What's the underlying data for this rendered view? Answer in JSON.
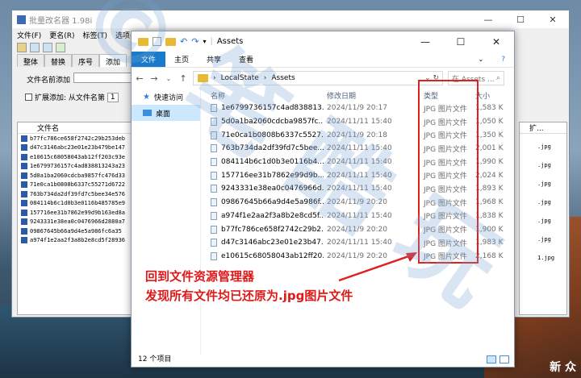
{
  "renamer": {
    "title": "批量改名器 1.98i",
    "menu": [
      "文件(F)",
      "更名(R)",
      "标签(T)",
      "选项(O)"
    ],
    "tabs": [
      "整体",
      "替换",
      "序号",
      "添加"
    ],
    "prefix_label": "文件名前添加",
    "ext_label": "扩展添加: 从文件名第",
    "ext_value": "1",
    "list_header": "文件名",
    "files": [
      "b77fc786ce658f2742c29b253deb",
      "d47c3146abc23e01e23b479be147",
      "e10615c68058043ab12ff203c93e",
      "1e6799736157c4ad838813243a23",
      "5d0a1ba2060cdcba9857fc476d33",
      "71e0ca1b0808b6337c55271d6722",
      "763b734da2df39fd7c5bee34e576",
      "084114b6c1d0b3e0116b485785e9",
      "157716ee31b7862e99d9b163ed8a",
      "9243331e38ea0c0476966d2880a7",
      "09867645b66a9d4e5a986fc6a35",
      "a974f1e2aa2f3a8b2e8cd5f28936"
    ],
    "right_header": "扩...",
    "right_items": [
      "",
      ".jpg",
      "",
      ".jpg",
      "",
      ".jpg",
      "",
      ".jpg",
      "",
      ".jpg",
      "",
      ".jpg",
      "",
      "1.jpg"
    ]
  },
  "explorer": {
    "title": "Assets",
    "ribbon": [
      "文件",
      "主页",
      "共享",
      "查看"
    ],
    "path": [
      "LocalState",
      "Assets"
    ],
    "search_placeholder": "在 Assets ...",
    "nav": [
      {
        "label": "快速访问",
        "icon": "star-icon"
      },
      {
        "label": "桌面",
        "icon": "desktop-icon"
      }
    ],
    "columns": {
      "name": "名称",
      "date": "修改日期",
      "type": "类型",
      "size": "大小"
    },
    "files": [
      {
        "name": "1e6799736157c4ad838813...",
        "date": "2024/11/9 20:17",
        "type": "JPG 图片文件",
        "size": "1,583 K"
      },
      {
        "name": "5d0a1ba2060cdcba9857fc...",
        "date": "2024/11/11 15:40",
        "type": "JPG 图片文件",
        "size": "1,050 K"
      },
      {
        "name": "71e0ca1b0808b6337c5527...",
        "date": "2024/11/9 20:18",
        "type": "JPG 图片文件",
        "size": "1,350 K"
      },
      {
        "name": "763b734da2df39fd7c5bee...",
        "date": "2024/11/11 15:40",
        "type": "JPG 图片文件",
        "size": "2,001 K"
      },
      {
        "name": "084114b6c1d0b3e0116b4...",
        "date": "2024/11/11 15:40",
        "type": "JPG 图片文件",
        "size": "1,990 K"
      },
      {
        "name": "157716ee31b7862e99d9b...",
        "date": "2024/11/11 15:40",
        "type": "JPG 图片文件",
        "size": "2,024 K"
      },
      {
        "name": "9243331e38ea0c0476966d...",
        "date": "2024/11/11 15:40",
        "type": "JPG 图片文件",
        "size": "1,893 K"
      },
      {
        "name": "09867645b66a9d4e5a986f...",
        "date": "2024/11/9 20:20",
        "type": "JPG 图片文件",
        "size": "1,968 K"
      },
      {
        "name": "a974f1e2aa2f3a8b2e8cd5f...",
        "date": "2024/11/11 15:40",
        "type": "JPG 图片文件",
        "size": "1,838 K"
      },
      {
        "name": "b77fc786ce658f2742c29b2...",
        "date": "2024/11/9 20:20",
        "type": "JPG 图片文件",
        "size": "1,900 K"
      },
      {
        "name": "d47c3146abc23e01e23b47...",
        "date": "2024/11/11 15:40",
        "type": "JPG 图片文件",
        "size": "1,983 K"
      },
      {
        "name": "e10615c68058043ab12ff20...",
        "date": "2024/11/9 20:20",
        "type": "JPG 图片文件",
        "size": "2,168 K"
      }
    ],
    "status": "12 个项目"
  },
  "annotation": {
    "line1": "回到文件资源管理器",
    "line2": "发现所有文件均已还原为.jpg图片文件",
    "color": "#e01818"
  },
  "watermark": {
    "text": "©笔酷玩",
    "logo": "新 众"
  }
}
